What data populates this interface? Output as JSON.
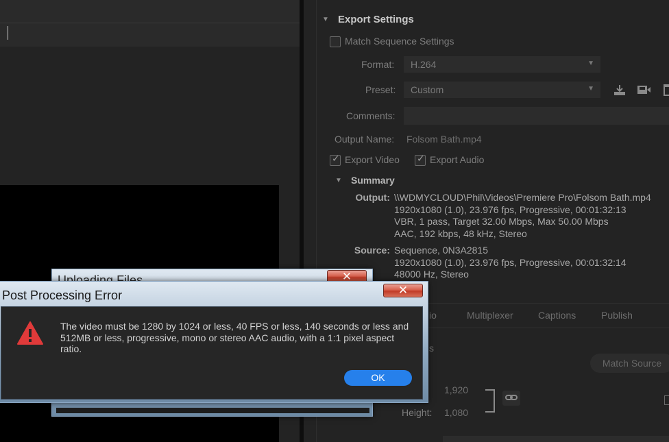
{
  "export_settings": {
    "section_title": "Export Settings",
    "match_sequence_label": "Match Sequence Settings",
    "format": {
      "label": "Format:",
      "value": "H.264"
    },
    "preset": {
      "label": "Preset:",
      "value": "Custom"
    },
    "comments_label": "Comments:",
    "output_name": {
      "label": "Output Name:",
      "value": "Folsom Bath.mp4"
    },
    "export_video_label": "Export Video",
    "export_audio_label": "Export Audio",
    "preset_icons": [
      "import-preset-icon",
      "save-preset-icon",
      "delete-preset-icon"
    ]
  },
  "summary": {
    "title": "Summary",
    "output_label": "Output:",
    "output_lines": [
      "\\\\WDMYCLOUD\\Phil\\Videos\\Premiere Pro\\Folsom Bath.mp4",
      "1920x1080 (1.0), 23.976 fps, Progressive, 00:01:32:13",
      "VBR, 1 pass, Target 32.00 Mbps, Max 50.00 Mbps",
      "AAC, 192 kbps, 48 kHz, Stereo"
    ],
    "source_label": "Source:",
    "source_lines": [
      "Sequence, 0N3A2815",
      "1920x1080 (1.0), 23.976 fps, Progressive, 00:01:32:14",
      "48000 Hz, Stereo"
    ]
  },
  "tabs": {
    "partial": "io",
    "multiplexer": "Multiplexer",
    "captions": "Captions",
    "publish": "Publish"
  },
  "video_section": {
    "partial_title": "s",
    "match_source_label": "Match Source",
    "width_value": "1,920",
    "height_label": "Height:",
    "height_value": "1,080"
  },
  "upload_dialog": {
    "title": "Uploading Files",
    "close_glyph": "✕"
  },
  "error_dialog": {
    "title": "Post Processing Error",
    "message": "The video must be 1280 by 1024 or less, 40 FPS or less, 140 seconds or less and 512MB or less, progressive, mono or stereo AAC audio, with a 1:1 pixel aspect ratio.",
    "ok_label": "OK",
    "close_glyph": "✕",
    "icon": "warning-icon",
    "icon_color": "#e03a3a"
  },
  "colors": {
    "accent": "#2680eb",
    "close": "#c8402c"
  }
}
